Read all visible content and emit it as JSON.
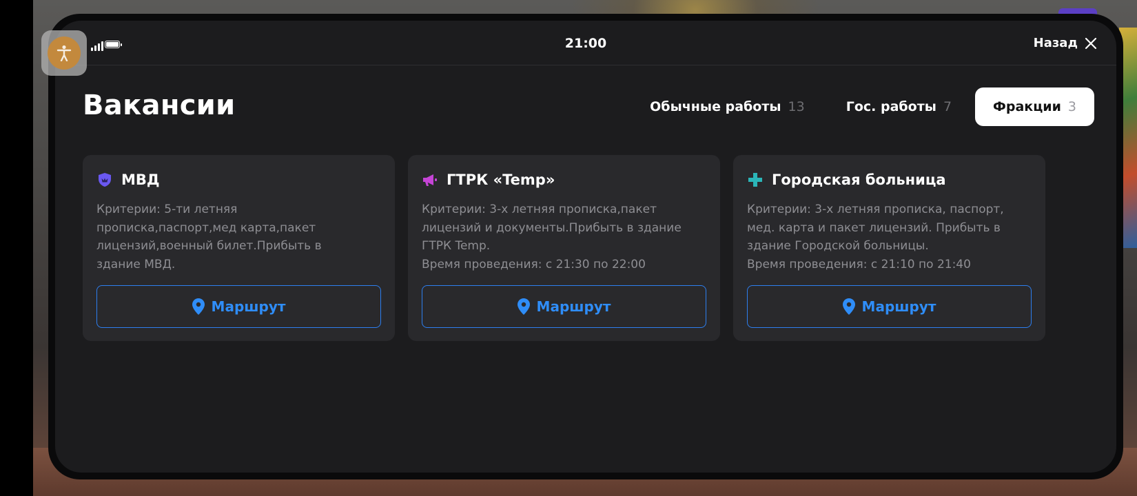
{
  "status_bar": {
    "time": "21:00"
  },
  "header": {
    "back_label": "Назад",
    "title": "Вакансии"
  },
  "tabs": [
    {
      "label": "Обычные работы",
      "count": "13",
      "active": false
    },
    {
      "label": "Гос. работы",
      "count": "7",
      "active": false
    },
    {
      "label": "Фракции",
      "count": "3",
      "active": true
    }
  ],
  "cards": [
    {
      "icon": "shield-icon",
      "icon_color": "#6a58f2",
      "title": "МВД",
      "description": "Критерии: 5-ти летняя\nпрописка,паспорт,мед карта,пакет\nлицензий,военный билет.Прибыть в\nздание МВД.",
      "route_label": "Маршрут"
    },
    {
      "icon": "megaphone-icon",
      "icon_color": "#c544d6",
      "title": "ГТРК «Temp»",
      "description": "Критерии:  3-х летняя прописка,пакет\nлицензий и документы.Прибыть в здание\nГТРК Temp.\nВремя проведения: с 21:30 по 22:00",
      "route_label": "Маршрут"
    },
    {
      "icon": "medical-cross-icon",
      "icon_color": "#2bb5b8",
      "title": "Городская больница",
      "description": "Критерии: 3-х летняя прописка, паспорт,\nмед. карта и пакет лицензий. Прибыть в\nздание Городской больницы.\nВремя проведения: с 21:10 по 21:40",
      "route_label": "Маршрут"
    }
  ],
  "colors": {
    "background": "#1c1c1e",
    "card": "#29292c",
    "accent": "#2f8df8",
    "muted_text": "#8e8e93"
  }
}
